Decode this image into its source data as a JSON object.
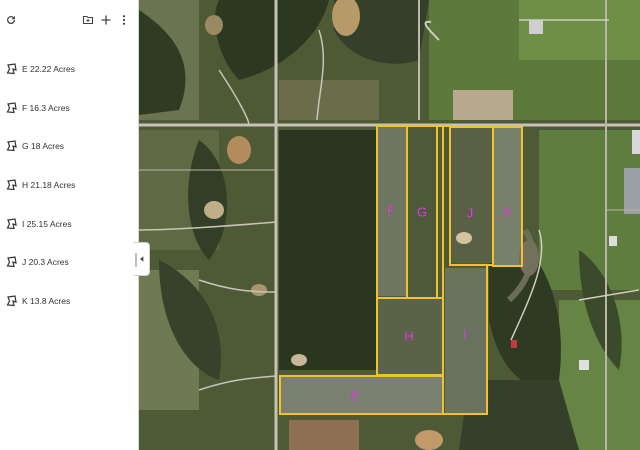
{
  "toolbar": {
    "refresh_icon": "refresh-icon",
    "new_folder_icon": "add-folder-icon",
    "add_icon": "plus-icon",
    "menu_icon": "more-vert-icon"
  },
  "plots": [
    {
      "id": "E",
      "label": "E 22.22 Acres"
    },
    {
      "id": "F",
      "label": "F 16.3 Acres"
    },
    {
      "id": "G",
      "label": "G 18 Acres"
    },
    {
      "id": "H",
      "label": "H 21.18 Acres"
    },
    {
      "id": "I",
      "label": "I 25.15 Acres"
    },
    {
      "id": "J",
      "label": "J 20.3 Acres"
    },
    {
      "id": "K",
      "label": "K 13.8 Acres"
    }
  ],
  "colors": {
    "boundary": "#f2c12e",
    "plot_label": "#e040e0",
    "sidebar_bg": "#ffffff"
  },
  "collapse_icon": "chevron-left-icon"
}
